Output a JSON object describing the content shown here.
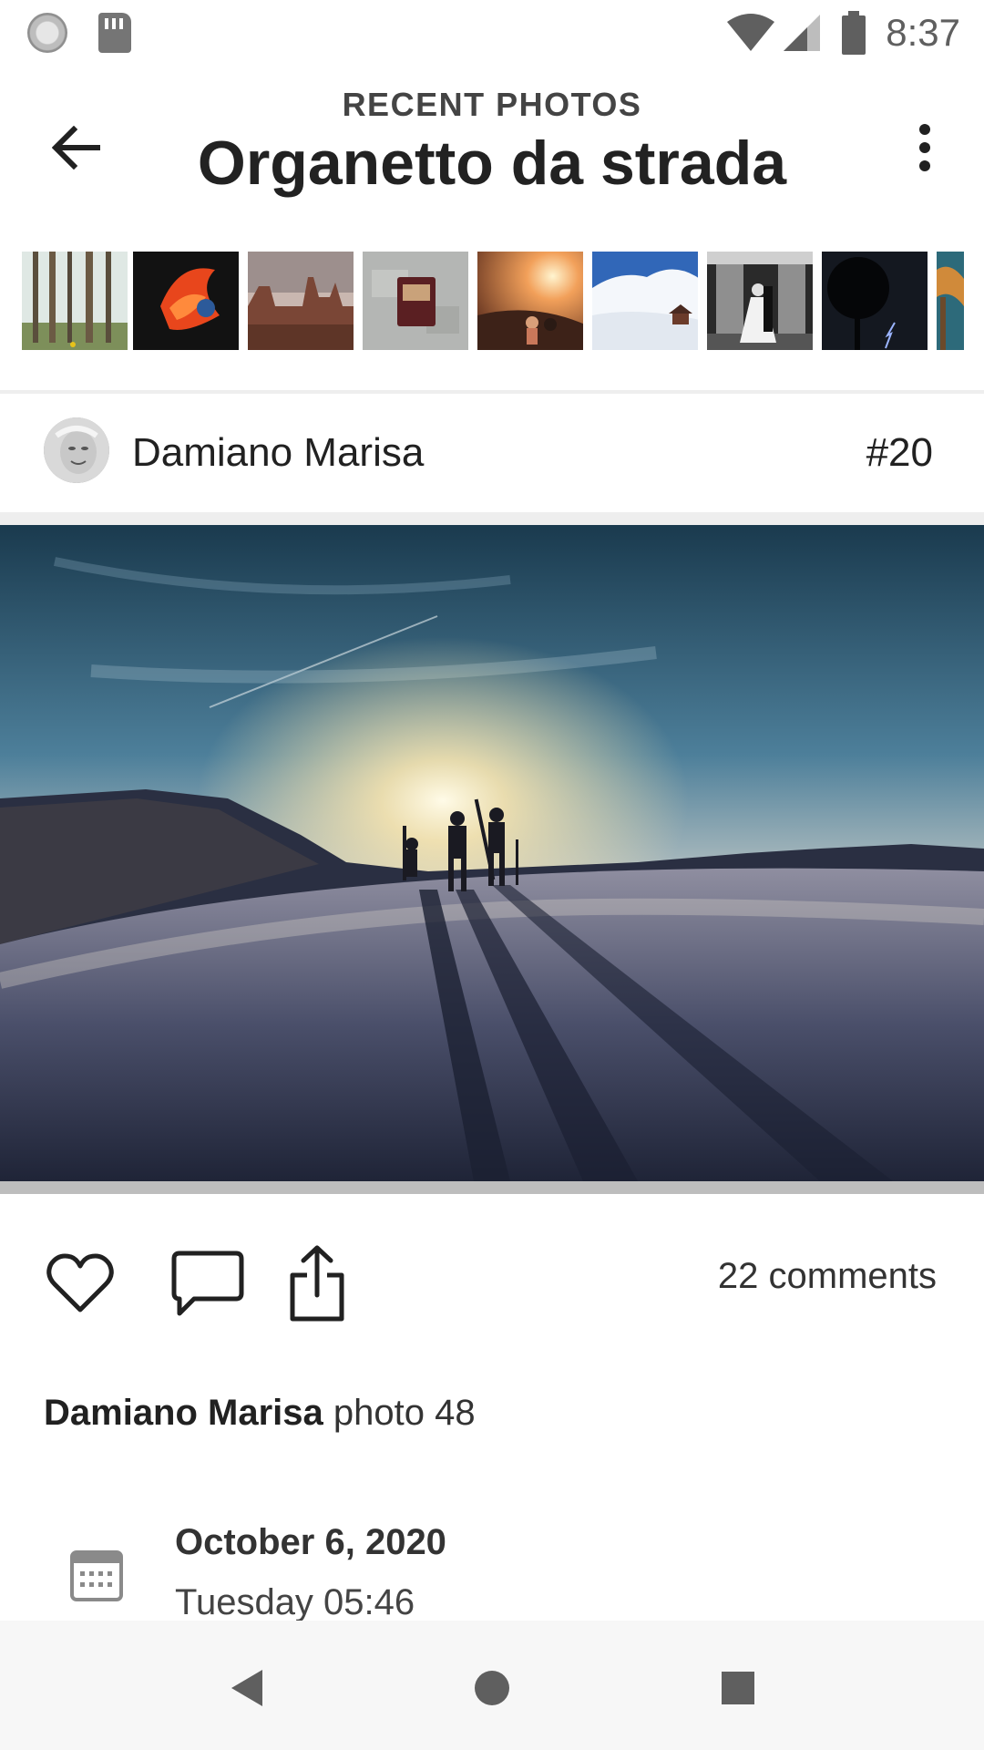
{
  "status_bar": {
    "time": "8:37",
    "icons": [
      "sync-icon",
      "sd-card-icon",
      "wifi-icon",
      "signal-icon",
      "battery-icon"
    ]
  },
  "app_bar": {
    "subtitle": "RECENT PHOTOS",
    "title": "Organetto da strada",
    "back_icon": "arrow-back-icon",
    "more_icon": "more-vert-icon"
  },
  "thumbnails": [
    {
      "name": "forest"
    },
    {
      "name": "betta-fish"
    },
    {
      "name": "desert-rocks"
    },
    {
      "name": "wallet"
    },
    {
      "name": "sunset-couple"
    },
    {
      "name": "snowy-mountain"
    },
    {
      "name": "wedding"
    },
    {
      "name": "lightning-tree"
    },
    {
      "name": "palm"
    }
  ],
  "post": {
    "author": "Damiano Marisa",
    "number": "#20",
    "comments": "22 comments",
    "caption_author": "Damiano Marisa",
    "caption_text": " photo 48",
    "date": "October 6, 2020",
    "time": "Tuesday 05:46"
  },
  "actions": {
    "like_icon": "heart-icon",
    "comment_icon": "comment-icon",
    "share_icon": "share-icon"
  },
  "nav": {
    "back_icon": "nav-back-icon",
    "home_icon": "nav-home-icon",
    "recents_icon": "nav-recents-icon"
  },
  "colors": {
    "text_primary": "#212121",
    "divider": "#eeeeee",
    "nav_bg": "#f7f7f7"
  }
}
